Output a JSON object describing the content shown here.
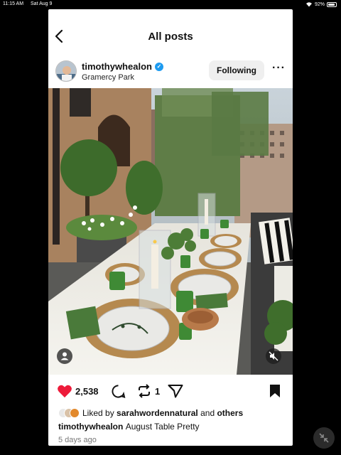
{
  "status_bar": {
    "time": "11:15 AM",
    "date": "Sat Aug 9",
    "battery": "92%",
    "battery_level": 0.92
  },
  "header": {
    "title": "All posts",
    "back_icon": "chevron-left-icon"
  },
  "post": {
    "username": "timothywhealon",
    "verified": true,
    "location": "Gramercy Park",
    "follow_label": "Following",
    "more_icon": "ellipsis-icon",
    "likes": "2,538",
    "reposts": "1",
    "liked_by_prefix": "Liked by",
    "liked_by_user": "sarahwordennatural",
    "liked_by_conjunction": "and",
    "liked_by_others": "others",
    "caption_user": "timothywhealon",
    "caption_text": "August Table Pretty",
    "timestamp": "5 days ago",
    "like_color": "#ed1b3a"
  }
}
